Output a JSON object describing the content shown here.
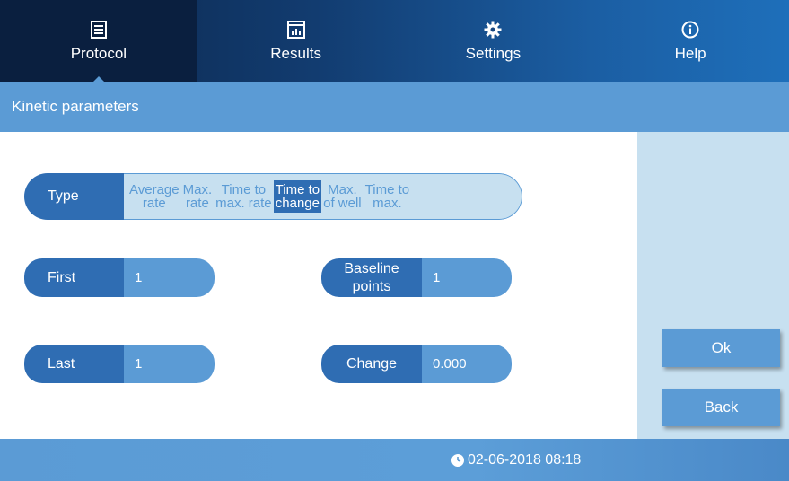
{
  "nav": {
    "tabs": [
      {
        "label": "Protocol",
        "icon": "protocol-icon",
        "active": true
      },
      {
        "label": "Results",
        "icon": "chart-icon",
        "active": false
      },
      {
        "label": "Settings",
        "icon": "gear-icon",
        "active": false
      },
      {
        "label": "Help",
        "icon": "info-icon",
        "active": false
      }
    ]
  },
  "page": {
    "title": "Kinetic parameters"
  },
  "type_selector": {
    "label": "Type",
    "options": [
      {
        "line1": "Average",
        "line2": "rate",
        "selected": false
      },
      {
        "line1": "Max.",
        "line2": "rate",
        "selected": false
      },
      {
        "line1": "Time to",
        "line2": "max. rate",
        "selected": false
      },
      {
        "line1": "Time to",
        "line2": "change",
        "selected": true
      },
      {
        "line1": "Max.",
        "line2": "of well",
        "selected": false
      },
      {
        "line1": "Time to",
        "line2": "max.",
        "selected": false
      }
    ]
  },
  "fields": {
    "first": {
      "label": "First",
      "value": "1"
    },
    "last": {
      "label": "Last",
      "value": "1"
    },
    "baseline": {
      "label_line1": "Baseline",
      "label_line2": "points",
      "value": "1"
    },
    "change": {
      "label": "Change",
      "value": "0.000"
    }
  },
  "actions": {
    "ok": "Ok",
    "back": "Back"
  },
  "status": {
    "datetime": "02-06-2018 08:18"
  },
  "colors": {
    "primary": "#5b9bd5",
    "dark": "#2f6db3",
    "light": "#c7e0f0",
    "nav_dark": "#0b2447"
  }
}
